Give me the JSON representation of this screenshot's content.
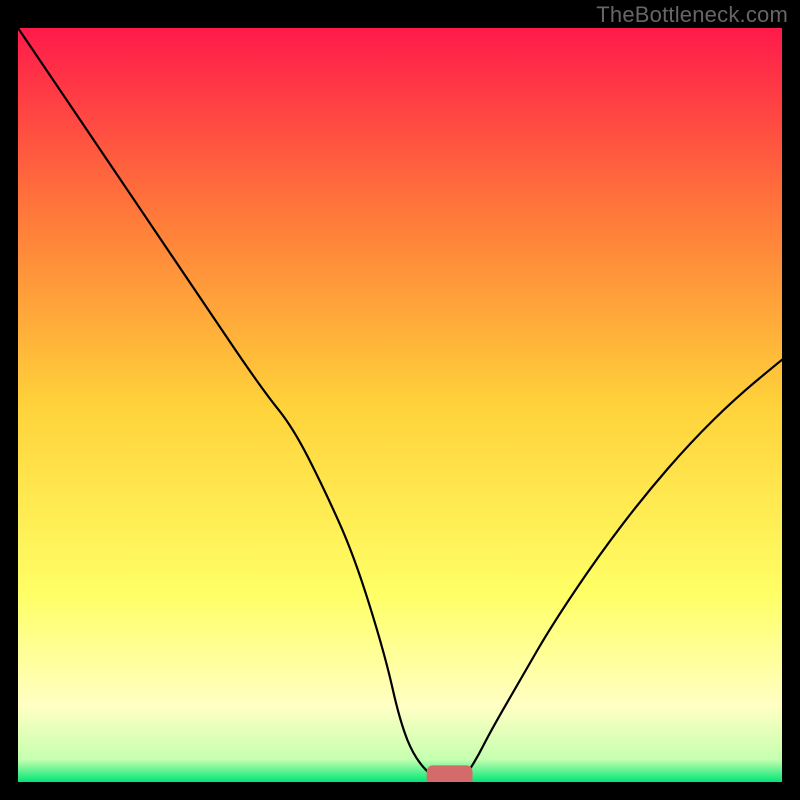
{
  "watermark": "TheBottleneck.com",
  "chart_data": {
    "type": "line",
    "title": "",
    "xlabel": "",
    "ylabel": "",
    "xlim": [
      0,
      100
    ],
    "ylim": [
      0,
      100
    ],
    "background_gradient": [
      {
        "stop": 0.0,
        "color": "#ff1a4a"
      },
      {
        "stop": 0.25,
        "color": "#ff7a3a"
      },
      {
        "stop": 0.5,
        "color": "#ffd23a"
      },
      {
        "stop": 0.75,
        "color": "#ffff66"
      },
      {
        "stop": 0.9,
        "color": "#ffffc4"
      },
      {
        "stop": 0.97,
        "color": "#c6ffb0"
      },
      {
        "stop": 1.0,
        "color": "#00e676"
      }
    ],
    "series": [
      {
        "name": "bottleneck-curve",
        "x": [
          0,
          8,
          16,
          24,
          32,
          36,
          40,
          44,
          48,
          50,
          52,
          55,
          58,
          60,
          62,
          66,
          70,
          76,
          82,
          88,
          94,
          100
        ],
        "values": [
          100,
          88,
          76,
          64,
          52,
          47,
          39,
          30,
          17,
          8,
          3,
          0,
          0,
          3,
          7,
          14,
          21,
          30,
          38,
          45,
          51,
          56
        ]
      }
    ],
    "marker": {
      "name": "optimal-point",
      "x": 56.5,
      "y": 0,
      "width": 6,
      "height": 2,
      "color": "#d46a6a"
    }
  }
}
